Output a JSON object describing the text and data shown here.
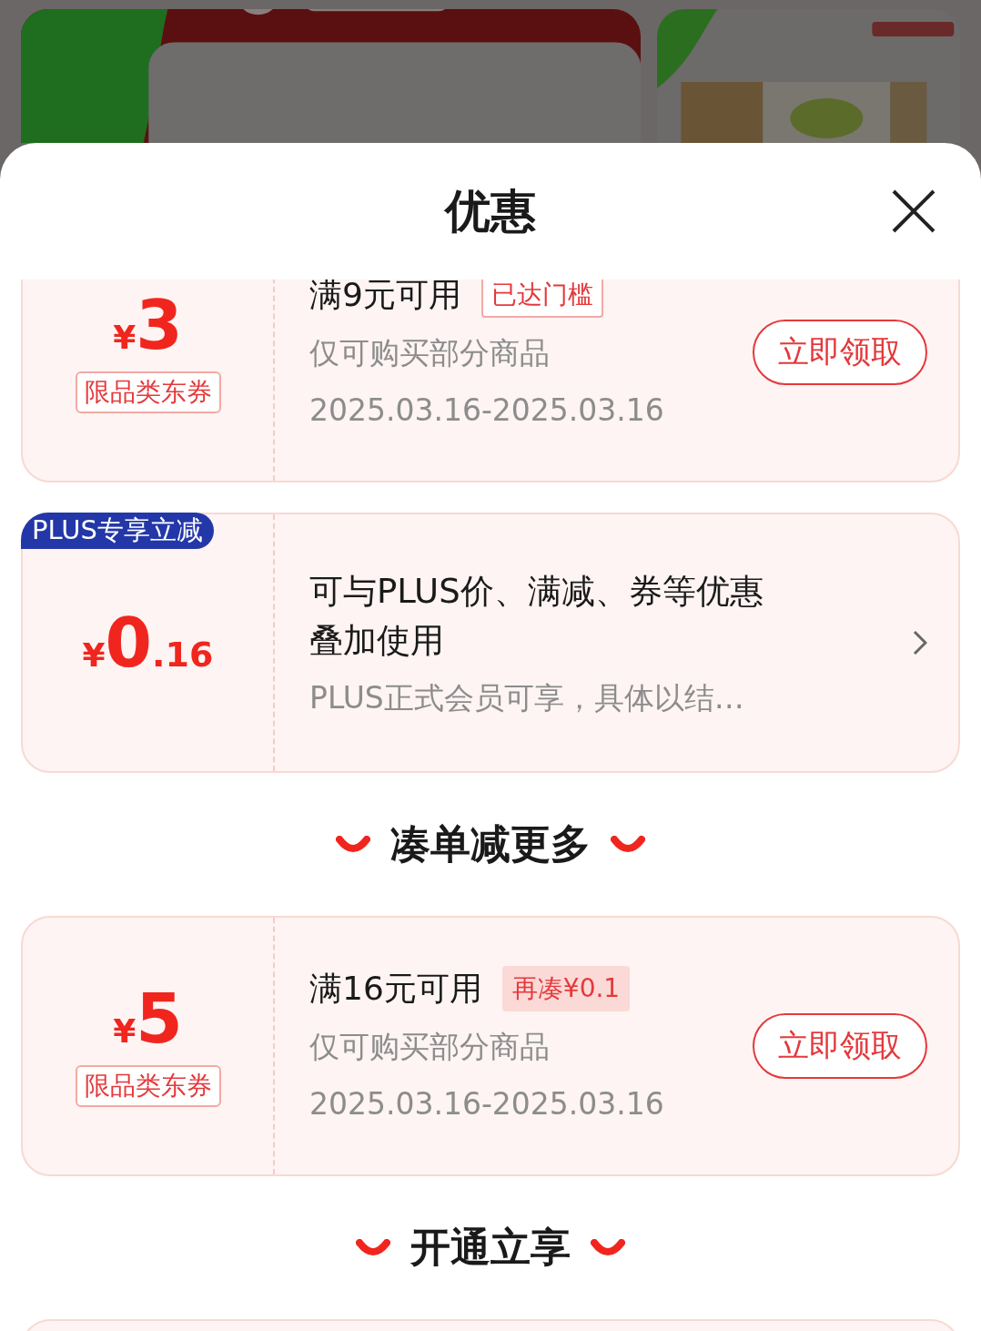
{
  "sheet": {
    "title": "优惠"
  },
  "sections": [
    {
      "coupons": [
        {
          "kind": "coupon",
          "currency": "¥",
          "amount": "3",
          "label": "限品类东券",
          "title": "满9元可用",
          "tag": {
            "text": "已达门槛",
            "kind": "reached"
          },
          "lines": [
            "仅可购买部分商品",
            "2025.03.16-2025.03.16"
          ],
          "action": "立即领取"
        },
        {
          "kind": "plus",
          "badge": "PLUS专享立减",
          "currency": "¥",
          "amount": "0",
          "decimal": ".16",
          "title": "可与PLUS价、满减、券等优惠叠加使用",
          "lines": [
            "PLUS正式会员可享，具体以结…"
          ]
        }
      ]
    },
    {
      "title": "凑单减更多",
      "coupons": [
        {
          "kind": "coupon",
          "currency": "¥",
          "amount": "5",
          "label": "限品类东券",
          "title": "满16元可用",
          "tag": {
            "text": "再凑¥0.1",
            "kind": "gap"
          },
          "lines": [
            "仅可购买部分商品",
            "2025.03.16-2025.03.16"
          ],
          "action": "立即领取"
        }
      ]
    },
    {
      "title": "开通立享"
    }
  ]
}
